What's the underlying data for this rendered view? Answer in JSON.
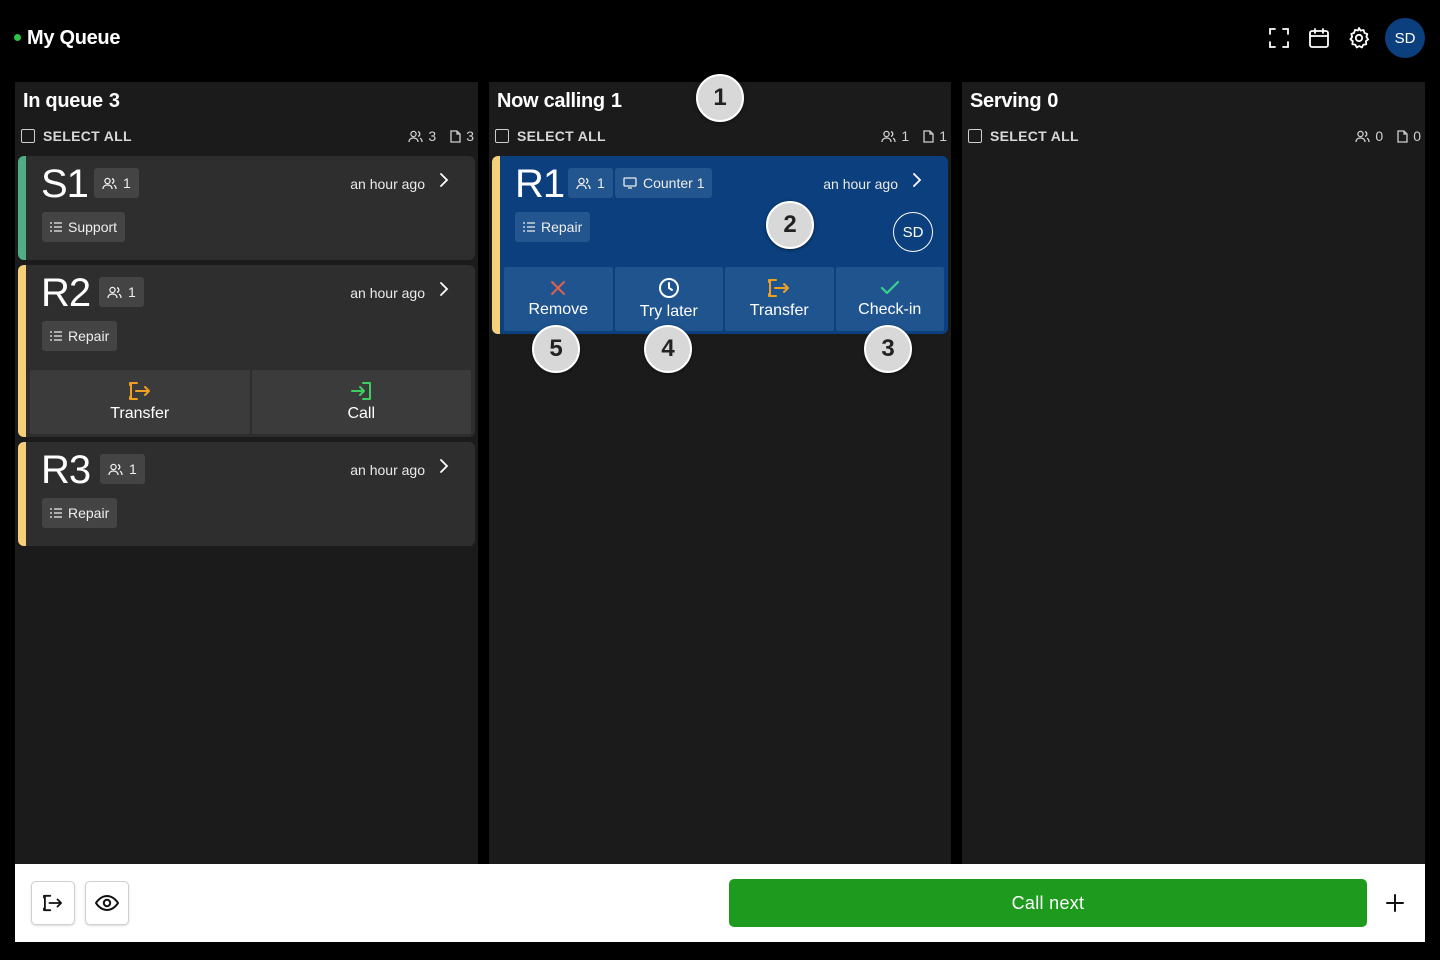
{
  "header": {
    "title": "My Queue",
    "avatar": "SD",
    "icons": [
      "fullscreen-icon",
      "calendar-icon",
      "settings-icon"
    ]
  },
  "columns": [
    {
      "title": "In queue",
      "count": "3",
      "select_all": "SELECT ALL",
      "people": "3",
      "docs": "3"
    },
    {
      "title": "Now calling",
      "count": "1",
      "select_all": "SELECT ALL",
      "people": "1",
      "docs": "1"
    },
    {
      "title": "Serving",
      "count": "0",
      "select_all": "SELECT ALL",
      "people": "0",
      "docs": "0"
    }
  ],
  "queue": [
    {
      "number": "S1",
      "party": "1",
      "time": "an hour ago",
      "service": "Support",
      "color": "#4fae86"
    },
    {
      "number": "R2",
      "party": "1",
      "time": "an hour ago",
      "service": "Repair",
      "color": "#f5cf7a",
      "actions": {
        "transfer": "Transfer",
        "call": "Call"
      }
    },
    {
      "number": "R3",
      "party": "1",
      "time": "an hour ago",
      "service": "Repair",
      "color": "#f5cf7a"
    }
  ],
  "calling": {
    "number": "R1",
    "party": "1",
    "counter": "Counter 1",
    "time": "an hour ago",
    "service": "Repair",
    "avatar": "SD",
    "color": "#f5cf7a",
    "actions": {
      "remove": "Remove",
      "try_later": "Try later",
      "transfer": "Transfer",
      "checkin": "Check-in"
    }
  },
  "markers": [
    "1",
    "2",
    "3",
    "4",
    "5"
  ],
  "footer": {
    "call_next": "Call next"
  },
  "colors": {
    "accent_green": "#1e9a1e",
    "calling_blue": "#0b3f7d",
    "orange": "#f0a020",
    "remove_red": "#e0604e",
    "checkin_green": "#3ccf8e"
  }
}
